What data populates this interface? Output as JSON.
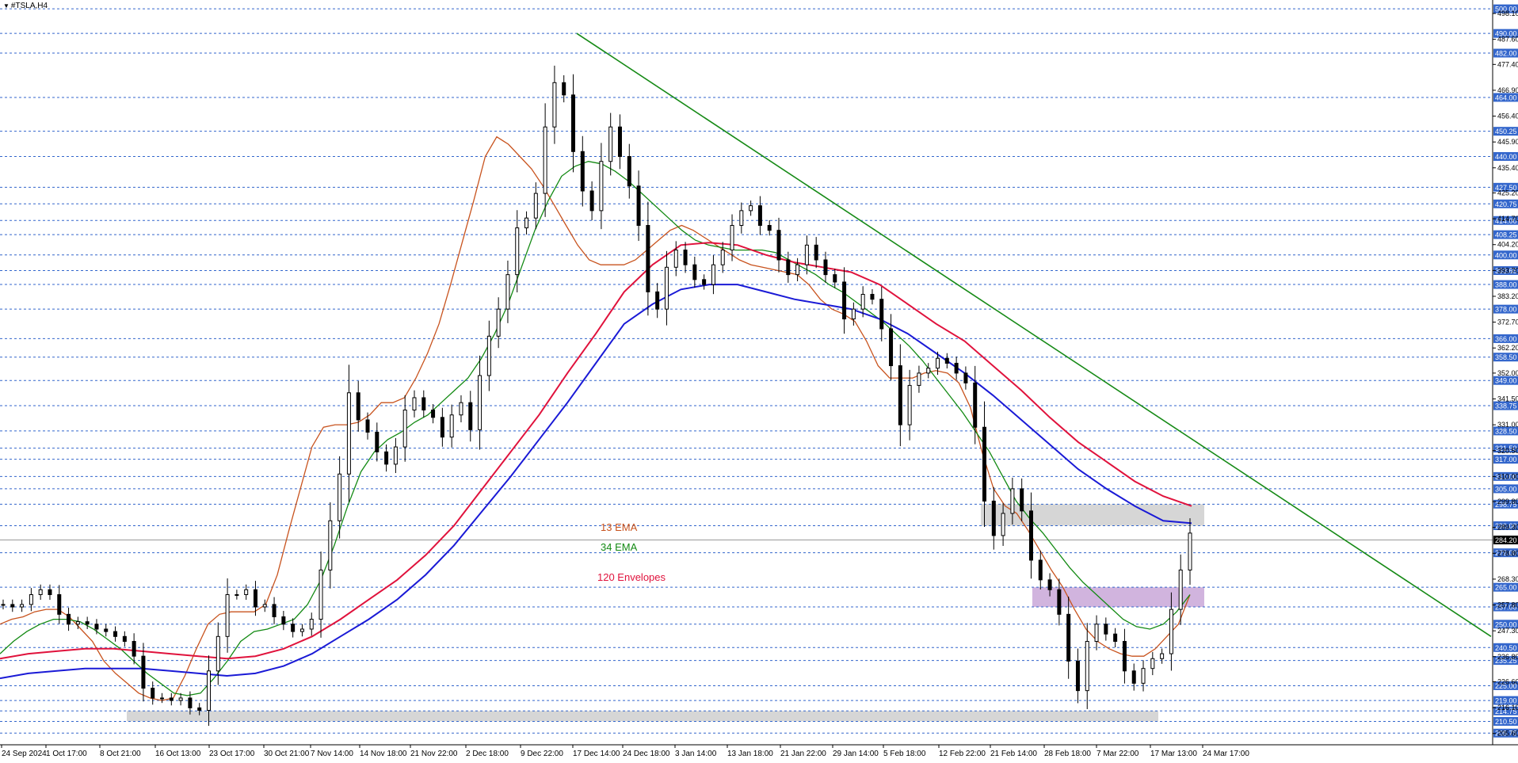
{
  "window": {
    "symbol_label": "#TSLA,H4"
  },
  "colors": {
    "ema13": "#c8531e",
    "ema34": "#138a13",
    "env_upper": "#e0123c",
    "env_lower": "#1a1ad6",
    "trendline": "#168a16",
    "grid_dash": "#3366cc",
    "tag_bg": "#3366cc",
    "zone_gray": "#cfcfcf",
    "zone_purple": "#c9a7d8",
    "candle": "#000000"
  },
  "chart_data": {
    "type": "candlestick",
    "ylim": [
      201.0,
      501.0
    ],
    "x_tick_labels": [
      "24 Sep 2024",
      "1 Oct 17:00",
      "8 Oct 21:00",
      "16 Oct 13:00",
      "23 Oct 17:00",
      "30 Oct 21:00",
      "7 Nov 14:00",
      "14 Nov 18:00",
      "21 Nov 22:00",
      "2 Dec 18:00",
      "9 Dec 22:00",
      "17 Dec 14:00",
      "24 Dec 18:00",
      "3 Jan 14:00",
      "13 Jan 18:00",
      "21 Jan 22:00",
      "29 Jan 14:00",
      "5 Feb 18:00",
      "12 Feb 22:00",
      "21 Feb 14:00",
      "28 Feb 18:00",
      "7 Mar 22:00",
      "17 Mar 13:00",
      "24 Mar 17:00"
    ],
    "price_scale_labels": [
      "498.10",
      "487.60",
      "477.40",
      "466.90",
      "456.40",
      "445.90",
      "435.40",
      "425.20",
      "414.70",
      "404.20",
      "393.70",
      "383.20",
      "372.70",
      "362.20",
      "352.00",
      "341.50",
      "331.00",
      "320.50",
      "310.00",
      "299.80",
      "289.30",
      "278.80",
      "268.30",
      "257.80",
      "247.30",
      "236.80",
      "226.60",
      "216.10",
      "205.60"
    ],
    "horizontal_levels": [
      "500.00",
      "490.00",
      "482.00",
      "464.00",
      "450.25",
      "440.00",
      "427.50",
      "420.75",
      "414.00",
      "408.25",
      "400.00",
      "393.65",
      "388.00",
      "378.00",
      "366.00",
      "358.50",
      "349.00",
      "338.75",
      "328.50",
      "321.50",
      "317.00",
      "310.00",
      "305.00",
      "298.75",
      "290.00",
      "279.00",
      "265.00",
      "257.00",
      "250.00",
      "240.50",
      "235.25",
      "225.00",
      "219.00",
      "214.75",
      "210.50",
      "205.75"
    ],
    "current_price": "284.20",
    "legend": [
      "13 EMA",
      "34 EMA",
      "120 Envelopes"
    ],
    "zones": [
      {
        "from_date": "16 Oct 2024",
        "to_date": "17 Mar 2025",
        "low": 210.5,
        "high": 214.75,
        "color": "gray"
      },
      {
        "from_date": "21 Feb 2025",
        "to_date": "27 Mar 2025",
        "low": 290.0,
        "high": 298.75,
        "color": "gray"
      },
      {
        "from_date": "28 Feb 2025",
        "to_date": "27 Mar 2025",
        "low": 257.0,
        "high": 265.0,
        "color": "purple"
      }
    ],
    "trendline": {
      "start": {
        "date": "17 Dec 2024",
        "price": 490.0
      },
      "end": {
        "date": "beyond 24 Mar 2025",
        "price": 245.0
      }
    },
    "series": [
      {
        "name": "price",
        "kind": "close",
        "values": [
          258,
          257,
          258,
          262,
          264,
          262,
          254,
          250,
          251,
          250,
          248,
          247,
          245,
          243,
          237,
          224,
          220,
          220,
          219,
          220,
          216,
          215,
          231,
          245,
          262,
          262,
          264,
          257,
          258,
          253,
          250,
          247,
          248,
          252,
          272,
          292,
          311,
          344,
          333,
          328,
          320,
          315,
          322,
          337,
          342,
          337,
          334,
          326,
          335,
          340,
          329,
          351,
          367,
          378,
          392,
          411,
          415,
          425,
          452,
          470,
          465,
          442,
          426,
          418,
          438,
          452,
          440,
          428,
          412,
          385,
          378,
          395,
          402,
          396,
          390,
          388,
          396,
          402,
          412,
          418,
          420,
          412,
          410,
          398,
          392,
          396,
          404,
          398,
          392,
          389,
          374,
          378,
          384,
          382,
          370,
          355,
          331,
          347,
          352,
          354,
          358,
          356,
          352,
          348,
          330,
          300,
          286,
          295,
          305,
          296,
          276,
          268,
          264,
          254,
          235,
          223,
          243,
          250,
          246,
          243,
          231,
          226,
          232,
          236,
          238,
          256,
          272,
          287
        ]
      },
      {
        "name": "13 EMA",
        "values": [
          250,
          252,
          253,
          255,
          256,
          256,
          253,
          248,
          243,
          235,
          230,
          226,
          222,
          220,
          219,
          220,
          229,
          240,
          250,
          254,
          255,
          255,
          255,
          258,
          270,
          288,
          305,
          322,
          330,
          331,
          331,
          332,
          335,
          340,
          340,
          342,
          350,
          360,
          372,
          388,
          405,
          422,
          440,
          448,
          445,
          440,
          435,
          428,
          420,
          412,
          404,
          398,
          396,
          396,
          396,
          398,
          402,
          406,
          410,
          412,
          410,
          407,
          404,
          401,
          398,
          396,
          395,
          394,
          393,
          392,
          388,
          382,
          378,
          376,
          373,
          365,
          355,
          350,
          350,
          350,
          352,
          353,
          352,
          348,
          338,
          320,
          305,
          298,
          295,
          288,
          280,
          272,
          265,
          256,
          248,
          243,
          240,
          238,
          237,
          237,
          240,
          245,
          250,
          262
        ]
      },
      {
        "name": "34 EMA",
        "values": [
          238,
          243,
          247,
          250,
          252,
          252,
          251,
          248,
          244,
          240,
          235,
          230,
          226,
          222,
          221,
          222,
          228,
          235,
          243,
          247,
          248,
          250,
          252,
          258,
          268,
          282,
          298,
          312,
          320,
          325,
          328,
          332,
          335,
          340,
          345,
          350,
          358,
          368,
          380,
          395,
          410,
          422,
          432,
          436,
          438,
          437,
          434,
          430,
          425,
          420,
          415,
          410,
          406,
          404,
          403,
          402,
          402,
          402,
          401,
          398,
          395,
          392,
          388,
          385,
          381,
          377,
          373,
          368,
          363,
          357,
          350,
          343,
          336,
          328,
          320,
          310,
          300,
          293,
          287,
          280,
          273,
          267,
          262,
          257,
          252,
          249,
          248,
          250,
          255,
          262
        ]
      },
      {
        "name": "120 Env upper",
        "values": [
          236,
          238,
          239,
          240,
          240,
          239,
          238,
          237,
          236,
          237,
          240,
          245,
          252,
          260,
          268,
          278,
          290,
          305,
          320,
          335,
          352,
          368,
          385,
          396,
          404,
          405,
          404,
          400,
          397,
          395,
          393,
          388,
          380,
          372,
          365,
          355,
          345,
          334,
          324,
          316,
          308,
          302,
          298
        ]
      },
      {
        "name": "120 Env lower",
        "values": [
          228,
          230,
          231,
          232,
          232,
          232,
          231,
          230,
          229,
          230,
          233,
          238,
          245,
          252,
          260,
          270,
          282,
          296,
          310,
          325,
          340,
          356,
          372,
          380,
          386,
          388,
          388,
          385,
          382,
          380,
          378,
          374,
          368,
          360,
          352,
          343,
          333,
          323,
          313,
          305,
          298,
          292,
          291
        ]
      }
    ]
  }
}
